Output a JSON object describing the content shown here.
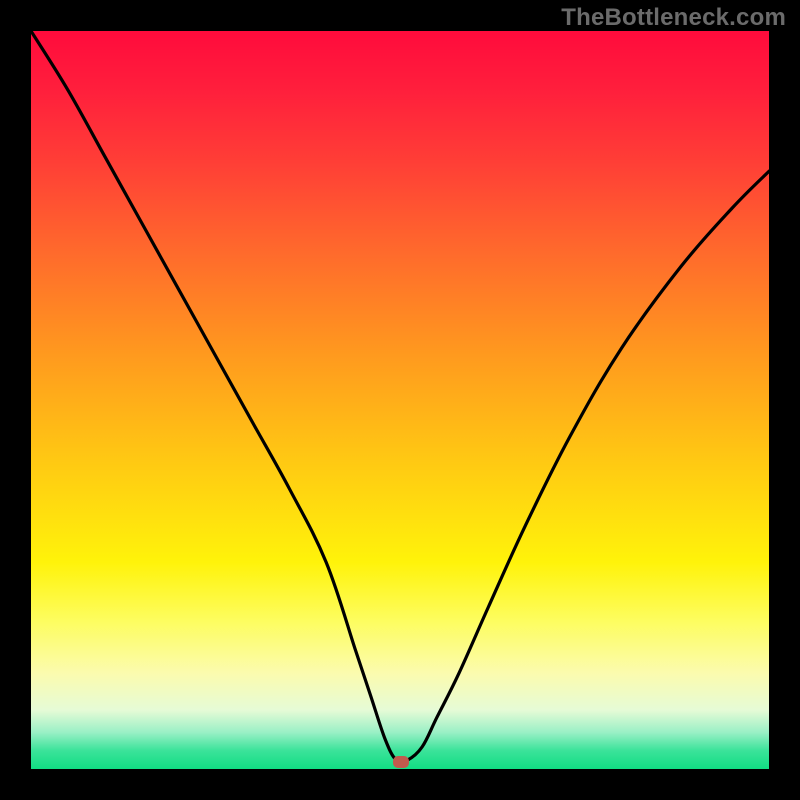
{
  "watermark": {
    "text": "TheBottleneck.com"
  },
  "chart_data": {
    "type": "line",
    "title": "",
    "xlabel": "",
    "ylabel": "",
    "xlim": [
      0,
      100
    ],
    "ylim": [
      0,
      100
    ],
    "grid": false,
    "legend": false,
    "background": "rainbow-gradient red→green top→bottom",
    "series": [
      {
        "name": "curve",
        "x": [
          0,
          5,
          10,
          15,
          20,
          25,
          30,
          35,
          40,
          44,
          46,
          48,
          49.5,
          51,
          53,
          55,
          58,
          62,
          67,
          73,
          80,
          88,
          95,
          100
        ],
        "y": [
          100,
          92,
          83,
          74,
          65,
          56,
          47,
          38,
          28,
          16,
          10,
          4,
          1.2,
          1.2,
          3,
          7,
          13,
          22,
          33,
          45,
          57,
          68,
          76,
          81
        ]
      }
    ],
    "marker": {
      "x": 50.2,
      "y": 1.0,
      "color": "#c15a4d"
    },
    "colors": {
      "curve": "#000000",
      "frame": "#000000",
      "gradient_top": "#ff0b3c",
      "gradient_bottom": "#11dd83"
    }
  }
}
